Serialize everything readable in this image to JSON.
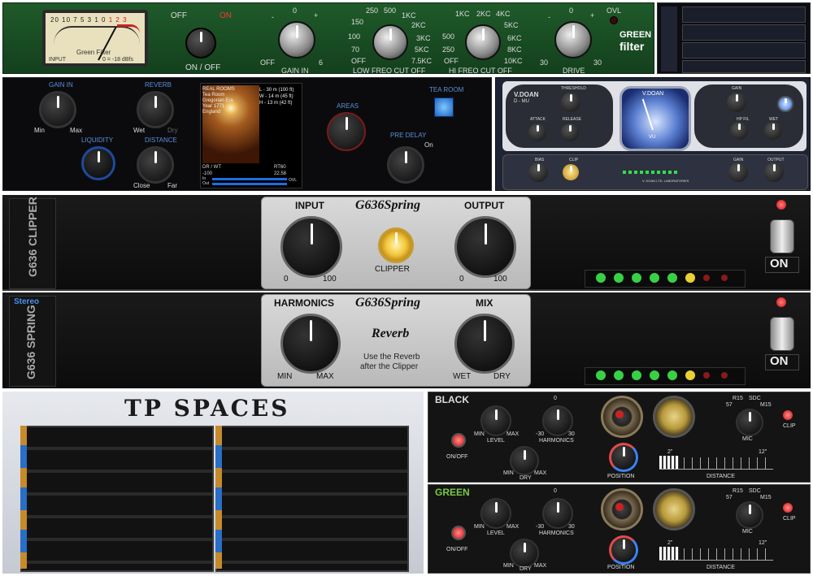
{
  "green_filter": {
    "vu_scale": [
      "20",
      "10",
      "7",
      "5",
      "3",
      "1",
      "0",
      "1",
      "2",
      "3"
    ],
    "vu_left_label": "INPUT",
    "vu_center_label": "Green Filter",
    "vu_right_label": "0 = -18 dBfs",
    "power_off": "OFF",
    "power_on": "ON",
    "power_label": "ON / OFF",
    "gain_top": "0",
    "gain_minus": "-",
    "gain_plus": "+",
    "gain_min": "OFF",
    "gain_max": "6",
    "gain_label": "GAIN IN",
    "low_marks": [
      "250",
      "500",
      "150",
      "1KC",
      "2KC",
      "100",
      "3KC",
      "70",
      "5KC",
      "OFF",
      "7.5KC"
    ],
    "hi_marks": [
      "1KC",
      "2KC",
      "4KC",
      "5KC",
      "500",
      "6KC",
      "250",
      "8KC",
      "OFF",
      "10KC"
    ],
    "low_label": "LOW  FREQ  CUT  OFF",
    "hi_label": "HI  FREQ  CUT  OFF",
    "drive_top": "0",
    "drive_minus": "-",
    "drive_plus": "+",
    "drive_min": "30",
    "drive_max": "30",
    "drive_label": "DRIVE",
    "ovl": "OVL",
    "brand_line1": "GREEN",
    "brand_line2": "filter"
  },
  "reverb": {
    "gain_in": "GAIN IN",
    "gain_min": "Min",
    "gain_max": "Max",
    "reverb": "REVERB",
    "wet": "Wet",
    "dry": "Dry",
    "liquidity": "LIQUIDITY",
    "distance": "DISTANCE",
    "close": "Close",
    "far": "Far",
    "info_left": [
      "REAL ROOMS",
      "Tea Room",
      "Gregorian Era",
      "Year 1771",
      "England"
    ],
    "info_right": [
      "L - 30 m (100 ft)",
      "W - 14 m (45 ft)",
      "H - 13 m (42 ft)"
    ],
    "dr_wt": "DR / WT",
    "dr_val": "-100",
    "rt_label": "RT60",
    "rt_val": "22.58",
    "in_label": "In",
    "out_label": "Out",
    "ovl": "OVL",
    "areas": "AREAS",
    "pre_delay": "PRE DELAY",
    "on": "On",
    "tea_room": "TEA ROOM"
  },
  "vdoan": {
    "brand_left": "V.DOAN",
    "brand_left_sub": "D - MU",
    "meter_brand": "V.DOAN",
    "meter_unit": "VU",
    "threshold": "THRESHOLD",
    "attack": "ATTACK",
    "release": "RELEASE",
    "gain": "GAIN",
    "hp_filter": "HP FIL",
    "wet": "WET",
    "bias": "BIAS",
    "clip": "CLIP",
    "gain2": "GAIN",
    "output": "OUTPUT",
    "maker": "V. DOAN LTD. LABORATORIES"
  },
  "g636_clipper": {
    "side": "G636 CLIPPER",
    "input": "INPUT",
    "output": "OUTPUT",
    "logo": "G636Spring",
    "clipper": "CLIPPER",
    "in_min": "0",
    "in_max": "100",
    "out_min": "0",
    "out_max": "100",
    "switch": "ON"
  },
  "g636_spring": {
    "stereo": "Stereo",
    "side": "G636 SPRING",
    "harmonics": "HARMONICS",
    "mix": "MIX",
    "logo": "G636Spring",
    "reverb": "Reverb",
    "note_line1": "Use the Reverb",
    "note_line2": "after the Clipper",
    "min": "MIN",
    "max": "MAX",
    "wet": "WET",
    "dry": "DRY",
    "switch": "ON"
  },
  "tp_spaces": {
    "title": "TP SPACES"
  },
  "amp_black": {
    "name": "BLACK",
    "level": "LEVEL",
    "level_min": "MIN",
    "level_max": "MAX",
    "harmonics": "HARMONICS",
    "h_min": "-30",
    "h_max": "30",
    "h_top": "0",
    "onoff": "ON/OFF",
    "dry": "DRY",
    "dry_min": "MIN",
    "dry_max": "MAX",
    "position": "POSITION",
    "mic": "MIC",
    "mic_opts": [
      "R15",
      "SDC",
      "57",
      "M15"
    ],
    "clip": "CLIP",
    "dist_min": "2\"",
    "dist_max": "12\"",
    "distance": "DISTANCE"
  },
  "amp_green": {
    "name": "GREEN",
    "level": "LEVEL",
    "level_min": "MIN",
    "level_max": "MAX",
    "harmonics": "HARMONICS",
    "h_min": "-30",
    "h_max": "30",
    "h_top": "0",
    "onoff": "ON/OFF",
    "dry": "DRY",
    "dry_min": "MIN",
    "dry_max": "MAX",
    "position": "POSITION",
    "mic": "MIC",
    "mic_opts": [
      "R15",
      "SDC",
      "57",
      "M15"
    ],
    "clip": "CLIP",
    "dist_min": "2\"",
    "dist_max": "12\"",
    "distance": "DISTANCE"
  }
}
